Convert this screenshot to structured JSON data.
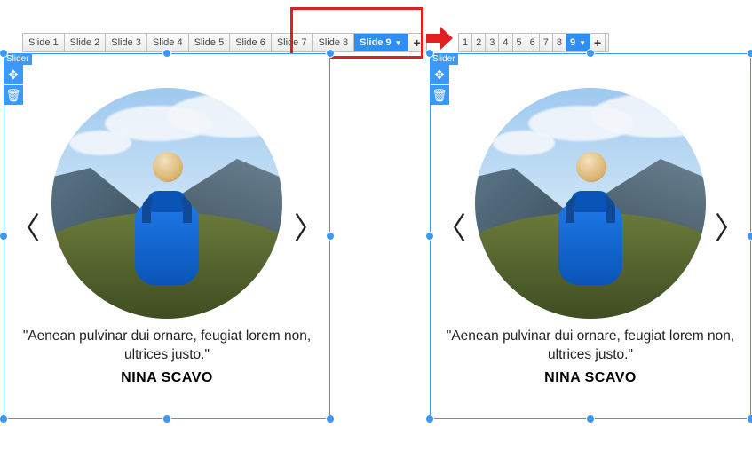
{
  "tabs_full": [
    "Slide 1",
    "Slide 2",
    "Slide 3",
    "Slide 4",
    "Slide 5",
    "Slide 6",
    "Slide 7",
    "Slide 8",
    "Slide 9"
  ],
  "tabs_short": [
    "1",
    "2",
    "3",
    "4",
    "5",
    "6",
    "7",
    "8",
    "9"
  ],
  "active_tab_label": "Slide 9",
  "active_tab_short": "9",
  "add_label": "+",
  "widget_tag": "Slider",
  "quote": "\"Aenean pulvinar dui ornare, feugiat lorem non, ultrices justo.\"",
  "author": "NINA SCAVO",
  "nav_prev": "〈",
  "nav_next": "〉"
}
